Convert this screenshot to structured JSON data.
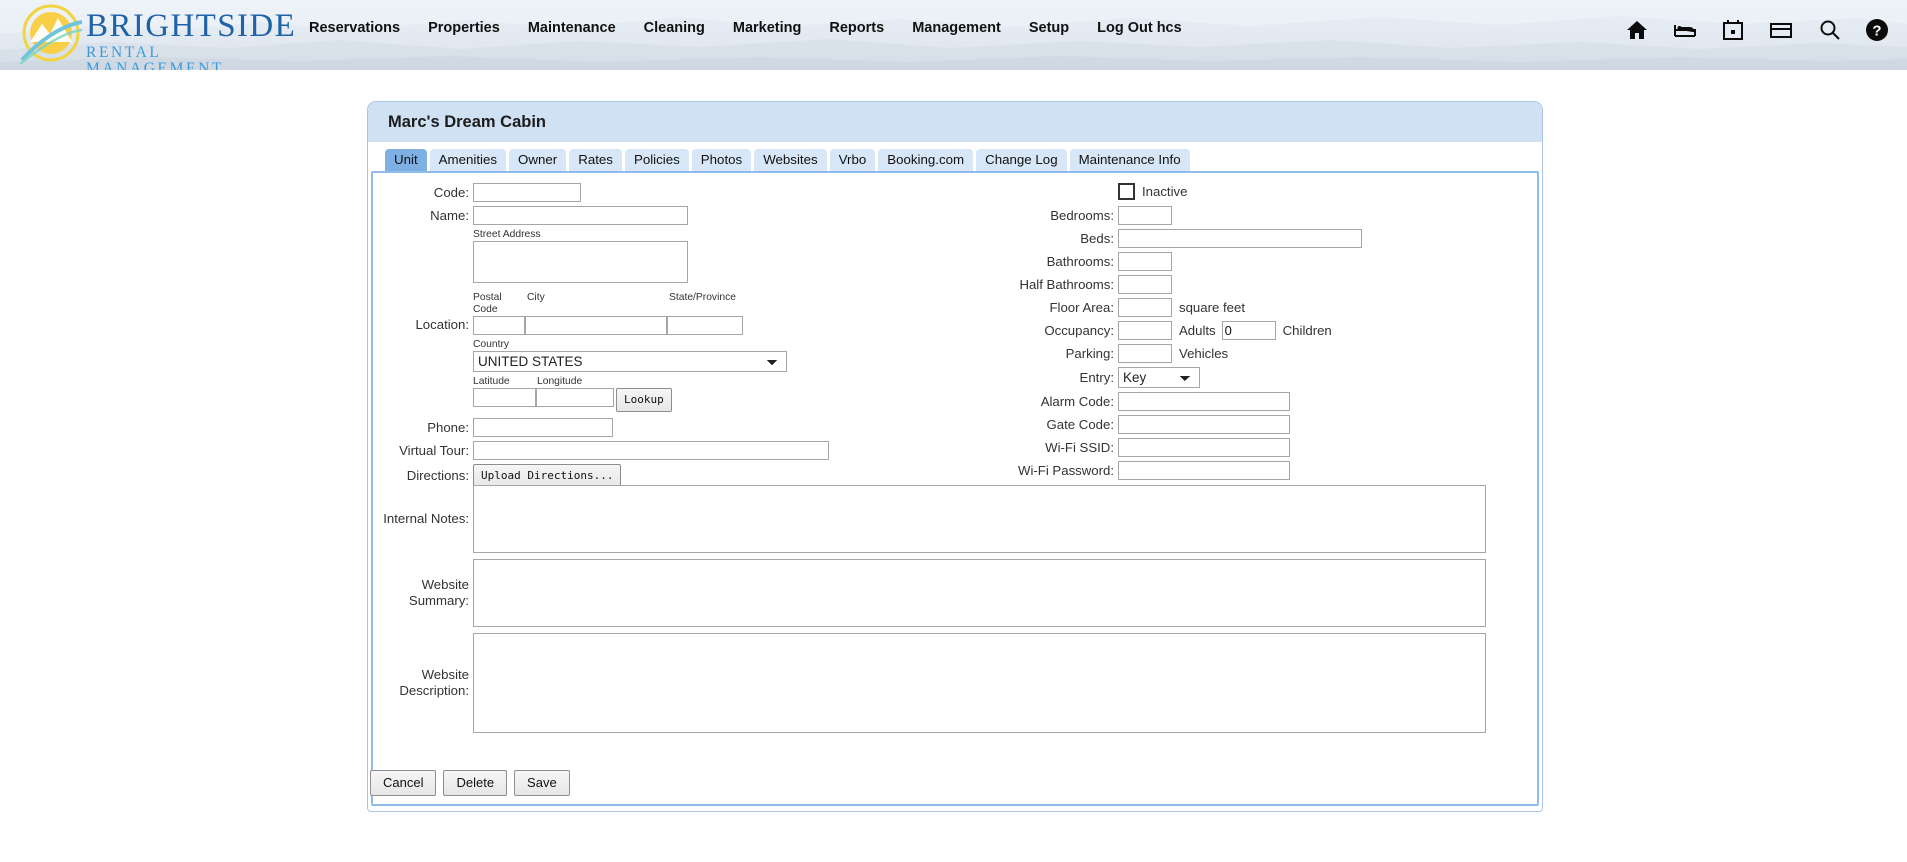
{
  "brand": {
    "name": "BRIGHTSIDE",
    "tagline": "RENTAL MANAGEMENT",
    "logo_icon": "sun-mountain-logo",
    "colors": {
      "title": "#1f62a8",
      "tagline": "#3a9ad9",
      "sun": "#f6c342",
      "swoosh": "#4fb3d0"
    }
  },
  "nav": {
    "items": [
      {
        "label": "Reservations",
        "name": "nav-reservations"
      },
      {
        "label": "Properties",
        "name": "nav-properties"
      },
      {
        "label": "Maintenance",
        "name": "nav-maintenance"
      },
      {
        "label": "Cleaning",
        "name": "nav-cleaning"
      },
      {
        "label": "Marketing",
        "name": "nav-marketing"
      },
      {
        "label": "Reports",
        "name": "nav-reports"
      },
      {
        "label": "Management",
        "name": "nav-management"
      },
      {
        "label": "Setup",
        "name": "nav-setup"
      },
      {
        "label": "Log Out hcs",
        "name": "nav-log-out"
      }
    ],
    "icons": [
      "home-icon",
      "bed-icon",
      "calendar-icon",
      "credit-card-icon",
      "search-icon",
      "help-icon"
    ]
  },
  "panel": {
    "title": "Marc's Dream Cabin",
    "tabs": [
      {
        "label": "Unit",
        "active": true
      },
      {
        "label": "Amenities",
        "active": false
      },
      {
        "label": "Owner",
        "active": false
      },
      {
        "label": "Rates",
        "active": false
      },
      {
        "label": "Policies",
        "active": false
      },
      {
        "label": "Photos",
        "active": false
      },
      {
        "label": "Websites",
        "active": false
      },
      {
        "label": "Vrbo",
        "active": false
      },
      {
        "label": "Booking.com",
        "active": false
      },
      {
        "label": "Change Log",
        "active": false
      },
      {
        "label": "Maintenance Info",
        "active": false
      }
    ]
  },
  "form": {
    "left": {
      "code_label": "Code:",
      "code_value": "",
      "name_label": "Name:",
      "name_value": "",
      "street_address_label": "Street Address",
      "street_address_value": "",
      "postal_code_label": "Postal Code",
      "postal_code_value": "",
      "city_label": "City",
      "city_value": "",
      "state_label": "State/Province",
      "state_value": "",
      "location_label": "Location:",
      "country_label": "Country",
      "country_value": "UNITED STATES",
      "country_options": [
        "UNITED STATES"
      ],
      "latitude_label": "Latitude",
      "latitude_value": "",
      "longitude_label": "Longitude",
      "longitude_value": "",
      "lookup_label": "Lookup",
      "phone_label": "Phone:",
      "phone_value": "",
      "virtual_tour_label": "Virtual Tour:",
      "virtual_tour_value": "",
      "directions_label": "Directions:",
      "upload_directions_label": "Upload Directions..."
    },
    "right": {
      "inactive_label": "Inactive",
      "inactive_checked": false,
      "bedrooms_label": "Bedrooms:",
      "bedrooms_value": "",
      "beds_label": "Beds:",
      "beds_value": "",
      "bathrooms_label": "Bathrooms:",
      "bathrooms_value": "",
      "half_bathrooms_label": "Half Bathrooms:",
      "half_bathrooms_value": "",
      "floor_area_label": "Floor Area:",
      "floor_area_value": "",
      "floor_area_unit": "square feet",
      "occupancy_label": "Occupancy:",
      "adults_value": "",
      "adults_unit": "Adults",
      "children_value": "0",
      "children_unit": "Children",
      "parking_label": "Parking:",
      "parking_value": "",
      "parking_unit": "Vehicles",
      "entry_label": "Entry:",
      "entry_value": "Key",
      "entry_options": [
        "Key"
      ],
      "alarm_code_label": "Alarm Code:",
      "alarm_code_value": "",
      "gate_code_label": "Gate Code:",
      "gate_code_value": "",
      "wifi_ssid_label": "Wi-Fi SSID:",
      "wifi_ssid_value": "",
      "wifi_password_label": "Wi-Fi Password:",
      "wifi_password_value": ""
    },
    "notes": {
      "internal_notes_label": "Internal Notes:",
      "internal_notes_value": "",
      "website_summary_label": "Website Summary:",
      "website_summary_value": "",
      "website_description_label_1": "Website",
      "website_description_label_2": "Description:",
      "website_description_value": ""
    }
  },
  "footer": {
    "cancel_label": "Cancel",
    "delete_label": "Delete",
    "save_label": "Save"
  }
}
